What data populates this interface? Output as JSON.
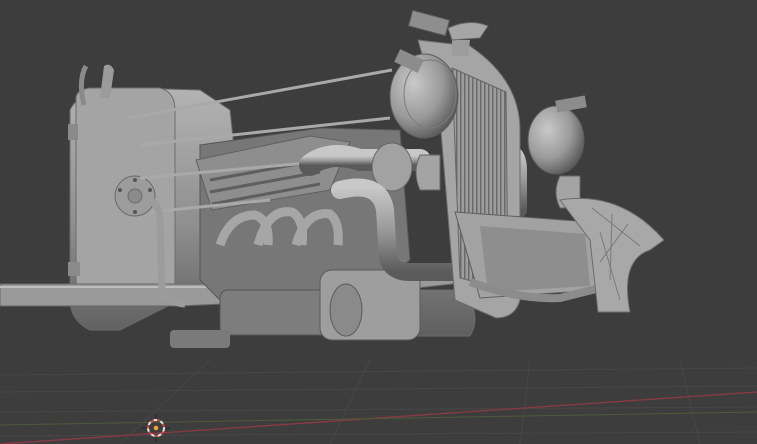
{
  "viewport": {
    "background_color": "#3d3d3d",
    "grid_color": "#474747",
    "x_axis_color": "#8b3a46",
    "model_base_color": "#8f8f8f",
    "model_light_color": "#b3b3b3",
    "model_shadow_color": "#5c5c5c"
  },
  "objects": [
    {
      "name": "hot-rod-engine-model",
      "icon": "mesh-object-icon"
    },
    {
      "name": "3d-cursor",
      "icon": "3d-cursor-icon"
    }
  ]
}
